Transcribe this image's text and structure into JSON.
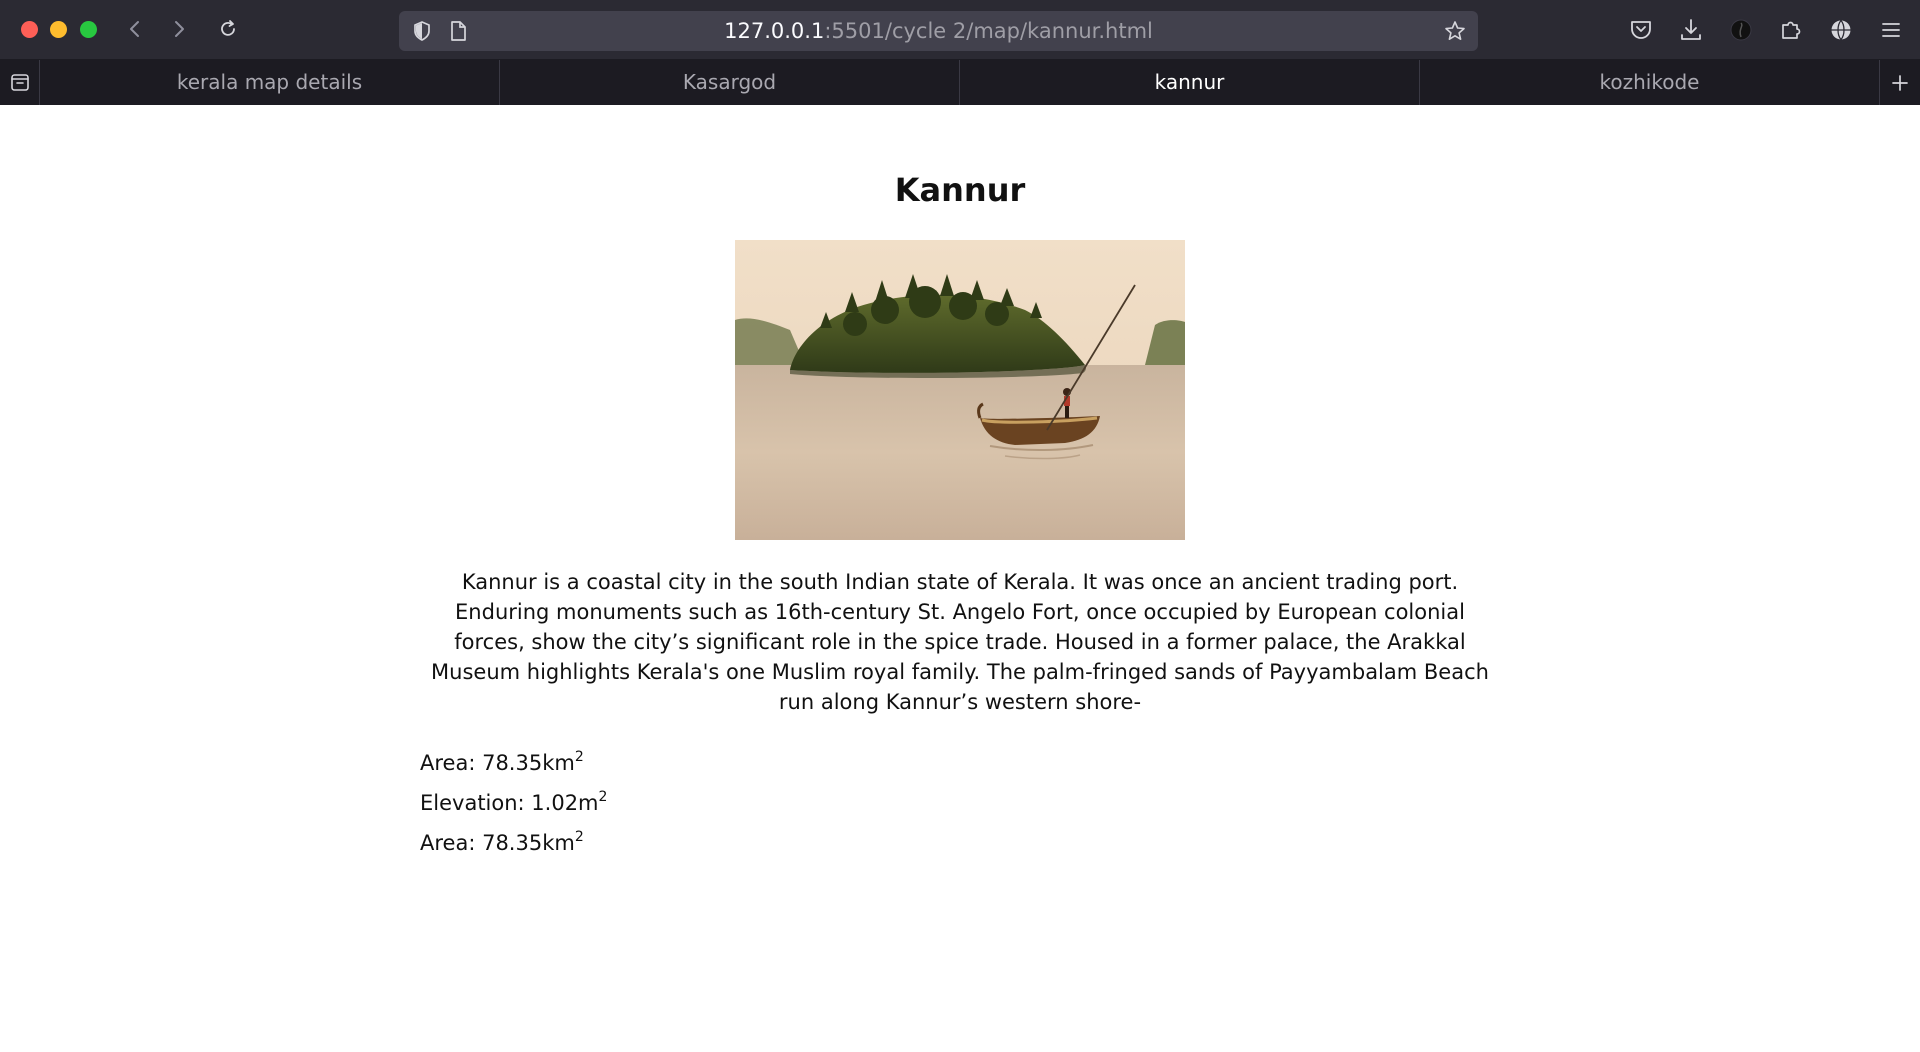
{
  "browser": {
    "url_host": "127.0.0.1",
    "url_rest": ":5501/cycle 2/map/kannur.html",
    "tabs": [
      {
        "label": "kerala map details",
        "active": false
      },
      {
        "label": "Kasargod",
        "active": false
      },
      {
        "label": "kannur",
        "active": true
      },
      {
        "label": "kozhikode",
        "active": false
      }
    ],
    "icons": {
      "back": "chevron-left-icon",
      "forward": "chevron-right-icon",
      "reload": "reload-icon",
      "shield": "tracking-protection-icon",
      "page": "page-info-icon",
      "bookmark": "star-icon",
      "pocket": "pocket-icon",
      "download": "download-icon",
      "account": "account-icon",
      "extensions": "puzzle-icon",
      "vpn": "globe-icon",
      "menu": "hamburger-menu-icon",
      "overview": "tab-overview-icon",
      "new_tab": "plus-icon"
    },
    "colors": {
      "toolbar": "#2b2a33",
      "tabstrip": "#1c1b22",
      "urlbar": "#42414d"
    }
  },
  "page": {
    "title": "Kannur",
    "image_alt": "Kannur backwaters",
    "description": "Kannur is a coastal city in the south Indian state of Kerala. It was once an ancient trading port. Enduring monuments such as 16th-century St. Angelo Fort, once occupied by European colonial forces, show the city’s significant role in the spice trade. Housed in a former palace, the Arakkal Museum highlights Kerala's one Muslim royal family. The palm-fringed sands of Payyambalam Beach run along Kannur’s western shore-",
    "facts": [
      {
        "label": "Area: 78.35km",
        "sup": "2"
      },
      {
        "label": "Elevation: 1.02m",
        "sup": "2"
      },
      {
        "label": "Area: 78.35km",
        "sup": "2"
      }
    ]
  }
}
